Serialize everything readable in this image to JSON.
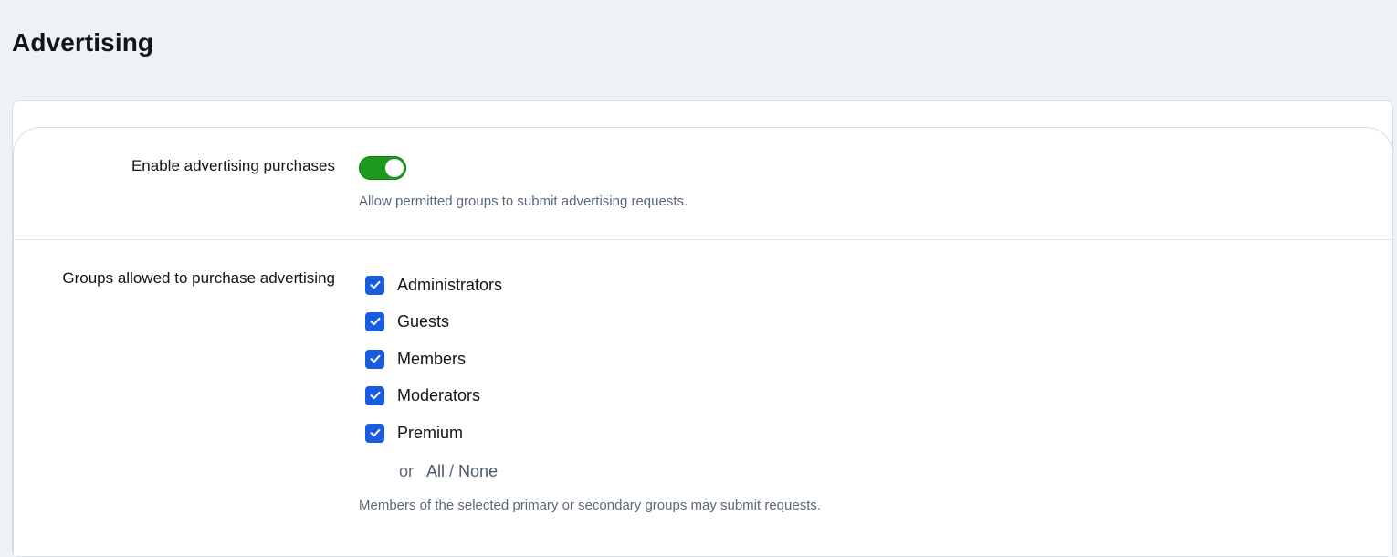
{
  "page": {
    "title": "Advertising"
  },
  "enable_purchases": {
    "label": "Enable advertising purchases",
    "enabled": true,
    "hint": "Allow permitted groups to submit advertising requests."
  },
  "groups": {
    "label": "Groups allowed to purchase advertising",
    "items": [
      {
        "label": "Administrators",
        "checked": true
      },
      {
        "label": "Guests",
        "checked": true
      },
      {
        "label": "Members",
        "checked": true
      },
      {
        "label": "Moderators",
        "checked": true
      },
      {
        "label": "Premium",
        "checked": true
      }
    ],
    "or_text": "or",
    "all_label": "All",
    "separator": " / ",
    "none_label": "None",
    "hint": "Members of the selected primary or secondary groups may submit requests."
  },
  "colors": {
    "toggle_on": "#1d9a1d",
    "checkbox_checked": "#1a5ce0",
    "background": "#eef1f6",
    "hint_text": "#5a6878"
  },
  "icons": {
    "checkmark": "check-icon"
  }
}
